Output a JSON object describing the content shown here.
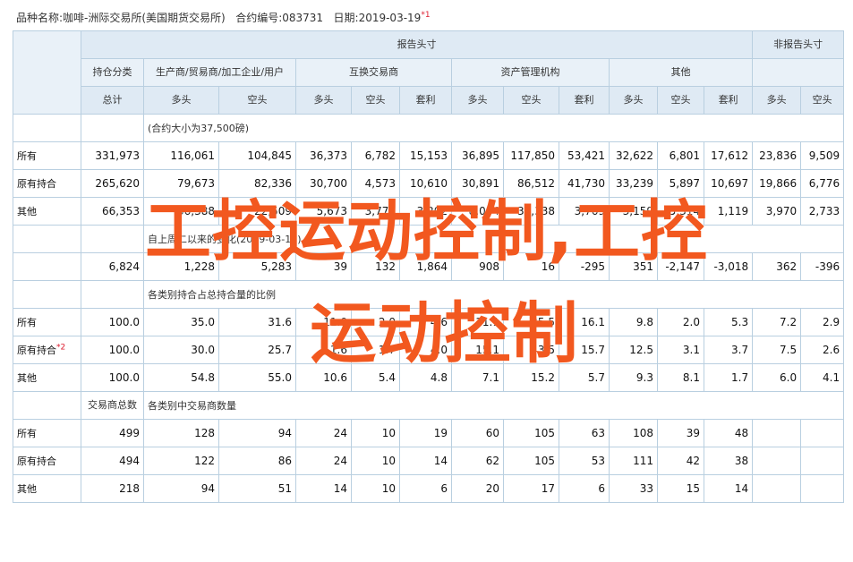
{
  "info": {
    "product_label": "品种名称:",
    "product_name": "咖啡-洲际交易所(美国期货交易所)",
    "code_label": "合约编号:",
    "code": "083731",
    "date_label": "日期:",
    "date": "2019-03-19",
    "date_note": "*1"
  },
  "header": {
    "reportable": "报告头寸",
    "nonreportable": "非报告头寸",
    "position_class": "持仓分类",
    "groups": [
      "生产商/贸易商/加工企业/用户",
      "互换交易商",
      "资产管理机构",
      "其他"
    ],
    "total": "总计",
    "long": "多头",
    "short": "空头",
    "spread": "套利"
  },
  "sections": {
    "contract_size": "(合约大小为37,500磅)",
    "change_since": "自上周二以来的变化(2019-03-12)",
    "pct_of_oi": "各类别持合占总持合量的比例",
    "traders_total": "交易商总数",
    "trader_count": "各类别中交易商数量"
  },
  "rows": {
    "positions": [
      {
        "label": "所有",
        "note": "",
        "values": [
          "331,973",
          "116,061",
          "104,845",
          "36,373",
          "6,782",
          "15,153",
          "36,895",
          "117,850",
          "53,421",
          "32,622",
          "6,801",
          "17,612",
          "23,836",
          "9,509"
        ]
      },
      {
        "label": "原有持合",
        "note": "",
        "values": [
          "265,620",
          "79,673",
          "82,336",
          "30,700",
          "4,573",
          "10,610",
          "30,891",
          "86,512",
          "41,730",
          "33,239",
          "5,897",
          "10,697",
          "19,866",
          "6,776"
        ]
      },
      {
        "label": "其他",
        "note": "",
        "values": [
          "66,353",
          "36,388",
          "22,509",
          "5,673",
          "3,770",
          "3,202",
          "8,004",
          "31,338",
          "3,769",
          "3,159",
          "5,314",
          "1,119",
          "3,970",
          "2,733"
        ]
      }
    ],
    "changes": [
      "6,824",
      "1,228",
      "5,283",
      "39",
      "132",
      "1,864",
      "908",
      "16",
      "-295",
      "351",
      "-2,147",
      "-3,018",
      "362",
      "-396"
    ],
    "percents": [
      {
        "label": "所有",
        "note": "",
        "values": [
          "100.0",
          "35.0",
          "31.6",
          "11.0",
          "2.0",
          "4.6",
          "11.1",
          "35.5",
          "16.1",
          "9.8",
          "2.0",
          "5.3",
          "7.2",
          "2.9"
        ]
      },
      {
        "label": "原有持合",
        "note": "*2",
        "values": [
          "100.0",
          "30.0",
          "25.7",
          "11.6",
          "1.7",
          "4.0",
          "15.1",
          "43.5",
          "15.7",
          "12.5",
          "3.1",
          "3.7",
          "7.5",
          "2.6"
        ]
      },
      {
        "label": "其他",
        "note": "",
        "values": [
          "100.0",
          "54.8",
          "55.0",
          "10.6",
          "5.4",
          "4.8",
          "7.1",
          "15.2",
          "5.7",
          "9.3",
          "8.1",
          "1.7",
          "6.0",
          "4.1"
        ]
      }
    ],
    "traders": [
      {
        "label": "所有",
        "note": "",
        "values": [
          "499",
          "128",
          "94",
          "24",
          "10",
          "19",
          "60",
          "105",
          "63",
          "108",
          "39",
          "48",
          "",
          ""
        ]
      },
      {
        "label": "原有持合",
        "note": "",
        "values": [
          "494",
          "122",
          "86",
          "24",
          "10",
          "14",
          "62",
          "105",
          "53",
          "111",
          "42",
          "38",
          "",
          ""
        ]
      },
      {
        "label": "其他",
        "note": "",
        "values": [
          "218",
          "94",
          "51",
          "14",
          "10",
          "6",
          "20",
          "17",
          "6",
          "33",
          "15",
          "14",
          "",
          ""
        ]
      }
    ]
  },
  "watermark": {
    "line1": "工控运动控制,工控",
    "line2": "运动控制"
  }
}
